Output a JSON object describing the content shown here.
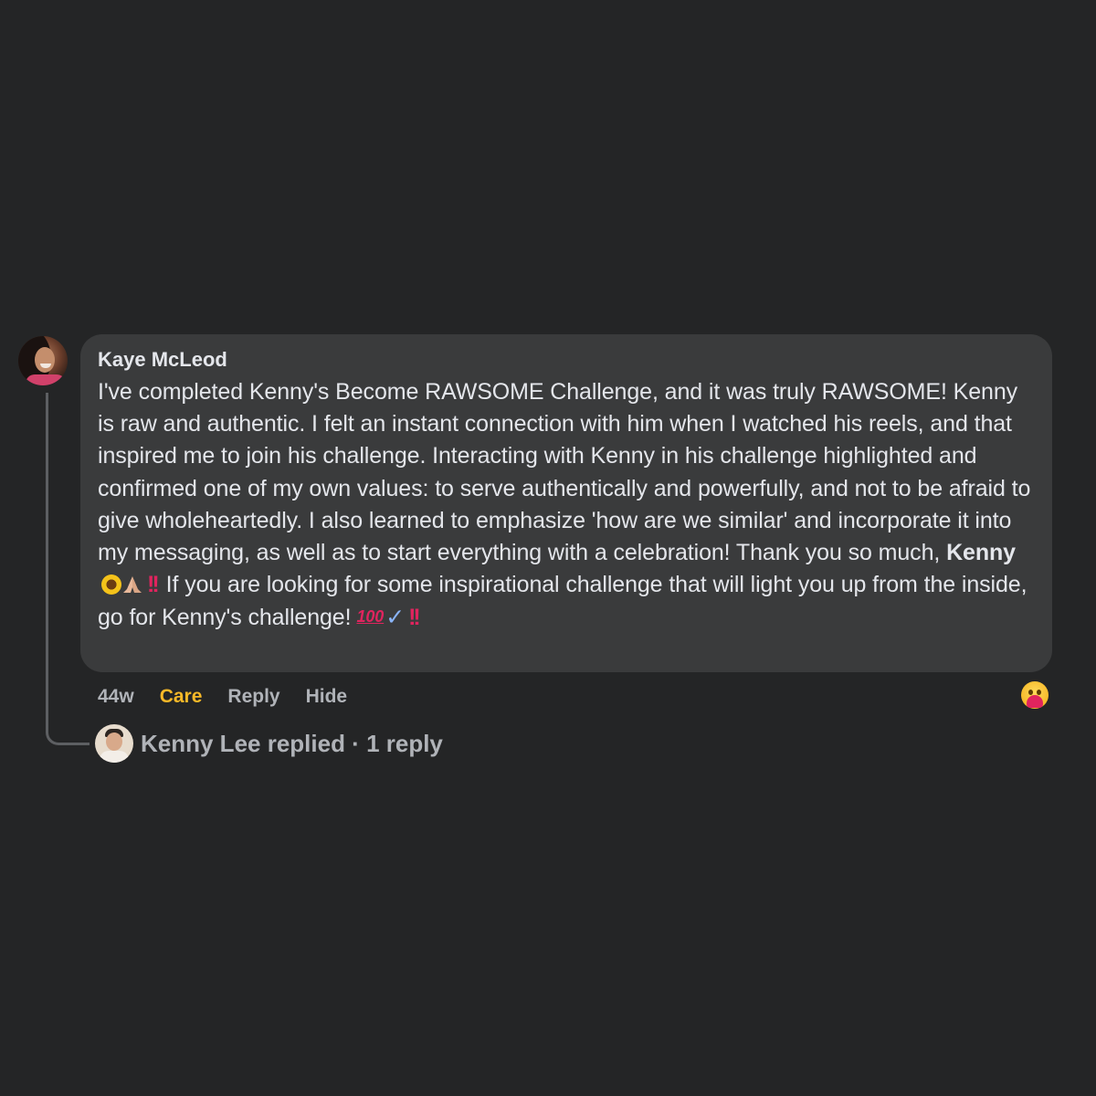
{
  "comment": {
    "author": "Kaye McLeod",
    "text_part1": "I've completed Kenny's Become RAWSOME Challenge, and it was truly RAWSOME! Kenny is raw and authentic. I felt an instant connection with him when I watched his reels, and that inspired me to join his challenge. Interacting with Kenny in his challenge highlighted and confirmed one of my own values: to serve authentically and powerfully, and not to be afraid to give wholeheartedly. I also learned to emphasize 'how are we similar' and incorporate it into my messaging, as well as to start everything with a celebration! Thank you so much, ",
    "mention": "Kenny",
    "text_part2": "If you are looking for some inspirational challenge that will light you up from the inside, go for Kenny's challenge!",
    "emoji_100": "100",
    "emoji_check": "✓",
    "emoji_bang": "!!",
    "emoji_bang_end": "!!"
  },
  "actions": {
    "time": "44w",
    "reaction_label": "Care",
    "reply_label": "Reply",
    "hide_label": "Hide"
  },
  "reaction_icon": "care-reaction-icon",
  "replies": {
    "summary": "Kenny Lee replied · 1 reply"
  },
  "colors": {
    "background": "#242526",
    "bubble": "#3a3b3c",
    "text": "#e4e6eb",
    "muted": "#b0b3b8",
    "care": "#f7b928"
  }
}
